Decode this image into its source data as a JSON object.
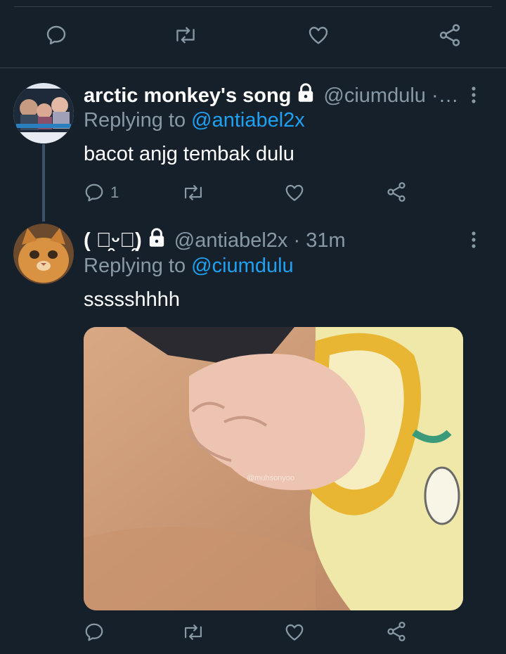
{
  "top_actions": {
    "icons": [
      "reply-icon",
      "retweet-icon",
      "like-icon",
      "share-icon"
    ]
  },
  "tweets": [
    {
      "display_name": "arctic monkey's song",
      "handle": "@ciumdulu ·…",
      "replying_label": "Replying to ",
      "replying_to": "@antiabel2x",
      "text": "bacot anjg tembak dulu",
      "reply_count": "1",
      "locked": true
    },
    {
      "display_name": "( ฺ̯ᵕฺ̯)",
      "handle": "@antiabel2x · 31m",
      "replying_label": "Replying to ",
      "replying_to": "@ciumdulu",
      "text": "ssssshhhh",
      "reply_count": "",
      "locked": true,
      "media_watermark": "@muhsonyoo"
    }
  ],
  "colors": {
    "background": "#15202b",
    "secondary_text": "#8899a6",
    "mention": "#1da1f2",
    "divider": "#38444d"
  }
}
